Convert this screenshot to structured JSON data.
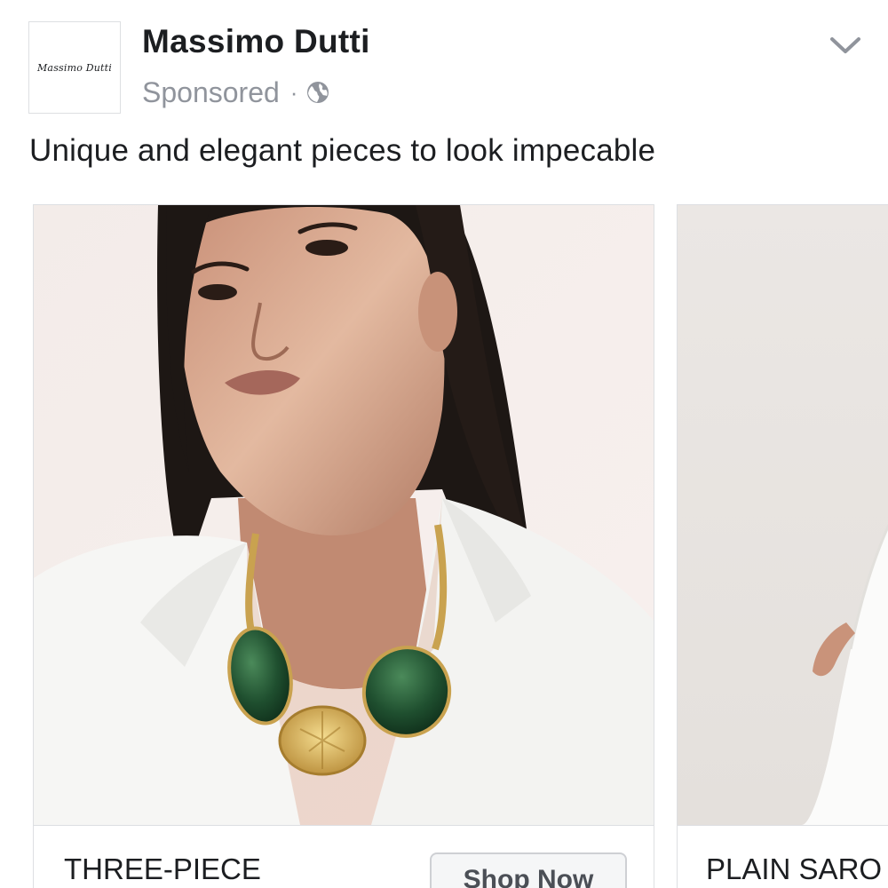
{
  "advertiser": {
    "name": "Massimo Dutti",
    "logo_text": "Massimo Dutti",
    "sponsored_label": "Sponsored",
    "separator": "·",
    "audience_icon": "globe-icon",
    "menu_icon": "chevron-down-icon"
  },
  "post": {
    "caption": "Unique and elegant pieces to look impecable"
  },
  "carousel": {
    "cards": [
      {
        "title": "THREE-PIECE",
        "cta_label": "Shop Now",
        "image_subject": "woman wearing white shirt and green stone gold necklace"
      },
      {
        "title": "PLAIN SARO",
        "image_subject": "model in white outfit"
      }
    ]
  },
  "colors": {
    "text_primary": "#1c1e21",
    "text_secondary": "#90949c",
    "border": "#dddfe2",
    "button_bg": "#f5f6f7"
  }
}
